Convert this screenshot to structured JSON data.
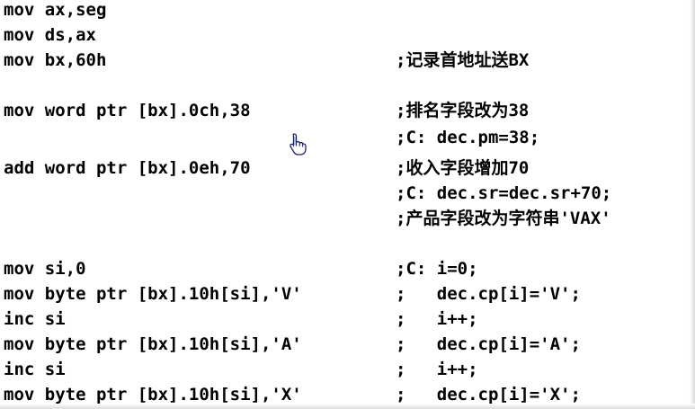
{
  "lines": [
    {
      "code": "mov ax,seg",
      "comment": ""
    },
    {
      "code": "mov ds,ax",
      "comment": ""
    },
    {
      "code": "mov bx,60h",
      "comment": ";记录首地址送BX"
    },
    {
      "code": "",
      "comment": ""
    },
    {
      "code": "mov word ptr [bx].0ch,38",
      "comment": ";排名字段改为38"
    },
    {
      "code": "",
      "comment": ";C: dec.pm=38;"
    },
    {
      "code": "add word ptr [bx].0eh,70",
      "comment": ";收入字段增加70"
    },
    {
      "code": "",
      "comment": ";C: dec.sr=dec.sr+70;"
    },
    {
      "code": "",
      "comment": ";产品字段改为字符串'VAX'"
    },
    {
      "code": "",
      "comment": ""
    },
    {
      "code": "mov si,0",
      "comment": ";C: i=0;"
    },
    {
      "code": "mov byte ptr [bx].10h[si],'V'",
      "comment": ";   dec.cp[i]='V';"
    },
    {
      "code": "inc si",
      "comment": ";   i++;"
    },
    {
      "code": "mov byte ptr [bx].10h[si],'A'",
      "comment": ";   dec.cp[i]='A';"
    },
    {
      "code": "inc si",
      "comment": ";   i++;"
    },
    {
      "code": "mov byte ptr [bx].10h[si],'X'",
      "comment": ";   dec.cp[i]='X';"
    }
  ],
  "icons": {
    "cursor": "hand-pointer-icon"
  },
  "colors": {
    "text": "#000000",
    "background": "#ffffff"
  }
}
